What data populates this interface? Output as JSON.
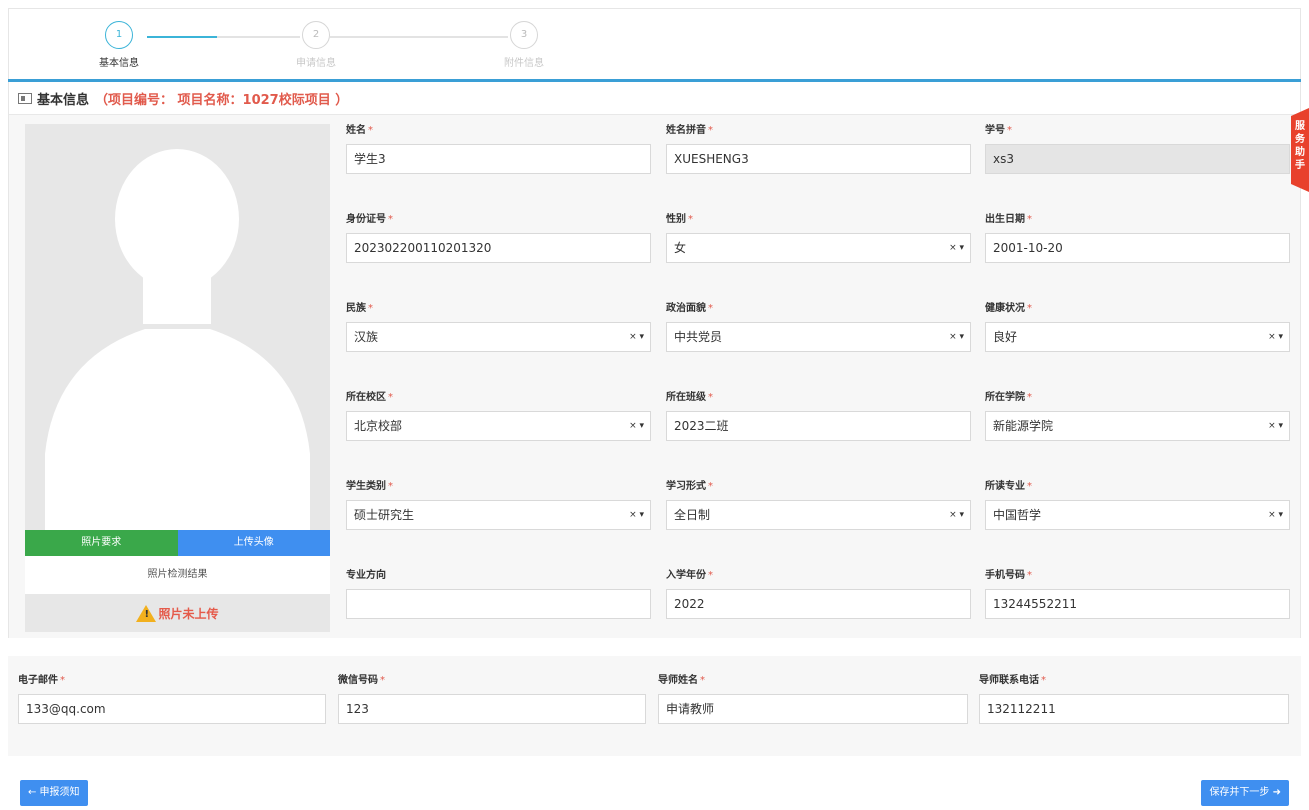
{
  "stepper": {
    "steps": [
      {
        "num": "1",
        "label": "基本信息"
      },
      {
        "num": "2",
        "label": "申请信息"
      },
      {
        "num": "3",
        "label": "附件信息"
      }
    ]
  },
  "header": {
    "title": "基本信息",
    "project": "（项目编号： 项目名称：1027校际项目 ）"
  },
  "photo": {
    "requirements_button": "照片要求",
    "upload_button": "上传头像",
    "check_title": "照片检测结果",
    "check_result": "照片未上传"
  },
  "side_tab": {
    "label": "服务助手"
  },
  "form": {
    "name": {
      "label": "姓名",
      "value": "学生3"
    },
    "pinyin": {
      "label": "姓名拼音",
      "value": "XUESHENG3"
    },
    "student_id": {
      "label": "学号",
      "value": "xs3"
    },
    "id_number": {
      "label": "身份证号",
      "value": "202302200110201320"
    },
    "gender": {
      "label": "性别",
      "value": "女"
    },
    "birth_date": {
      "label": "出生日期",
      "value": "2001-10-20"
    },
    "ethnicity": {
      "label": "民族",
      "value": "汉族"
    },
    "political": {
      "label": "政治面貌",
      "value": "中共党员"
    },
    "health": {
      "label": "健康状况",
      "value": "良好"
    },
    "campus": {
      "label": "所在校区",
      "value": "北京校部"
    },
    "class": {
      "label": "所在班级",
      "value": "2023二班"
    },
    "college": {
      "label": "所在学院",
      "value": "新能源学院"
    },
    "student_type": {
      "label": "学生类别",
      "value": "硕士研究生"
    },
    "study_mode": {
      "label": "学习形式",
      "value": "全日制"
    },
    "major": {
      "label": "所读专业",
      "value": "中国哲学"
    },
    "direction": {
      "label": "专业方向",
      "value": ""
    },
    "enroll_year": {
      "label": "入学年份",
      "value": "2022"
    },
    "phone": {
      "label": "手机号码",
      "value": "13244552211"
    },
    "email": {
      "label": "电子邮件",
      "value": "133@qq.com"
    },
    "wechat": {
      "label": "微信号码",
      "value": "123"
    },
    "tutor_name": {
      "label": "导师姓名",
      "value": "申请教师"
    },
    "tutor_phone": {
      "label": "导师联系电话",
      "value": "132112211"
    }
  },
  "select_marker": "× ▾",
  "required_mark": "*",
  "footer": {
    "back_button": "← 申报须知",
    "next_button": "保存并下一步 ➜"
  }
}
